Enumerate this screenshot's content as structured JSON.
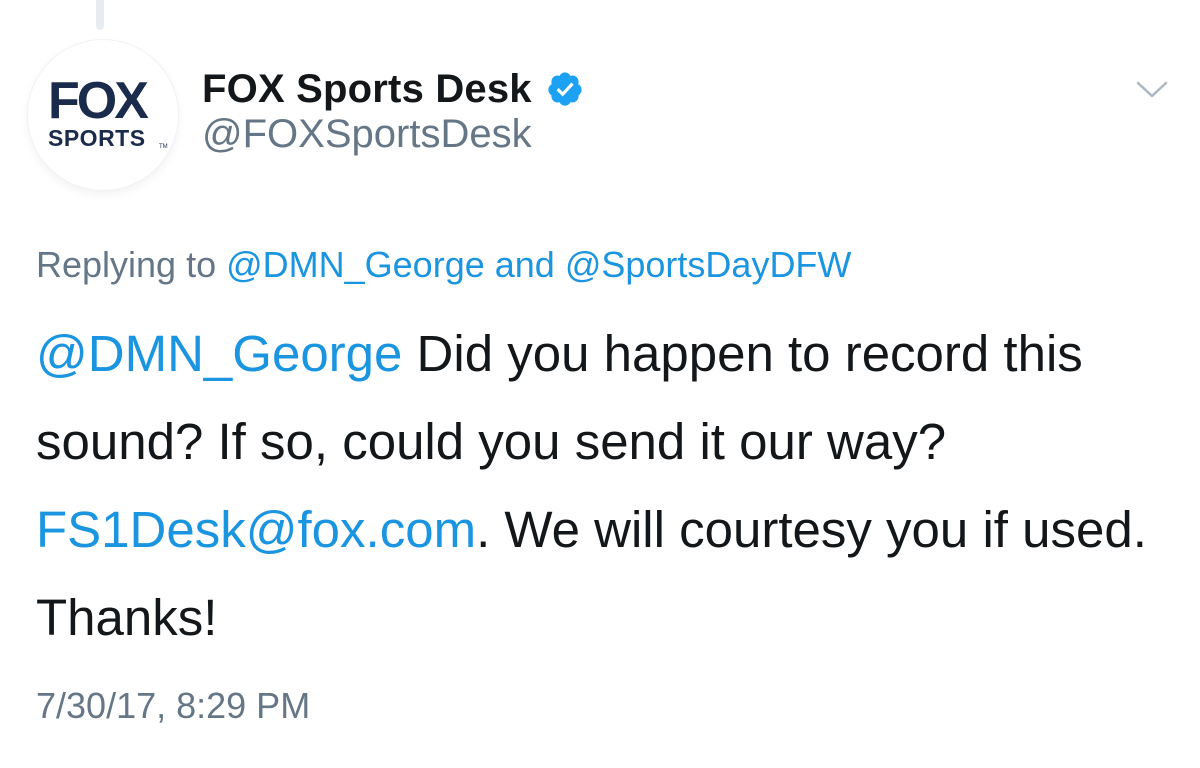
{
  "author": {
    "display_name": "FOX Sports Desk",
    "handle": "@FOXSportsDesk",
    "verified": true,
    "avatar_logo": {
      "top_text": "FOX",
      "bottom_text": "SPORTS",
      "trademark": "TM"
    }
  },
  "reply_context": {
    "prefix": "Replying to ",
    "user1": "@DMN_George",
    "conjunction": " and ",
    "user2": "@SportsDayDFW"
  },
  "tweet": {
    "mention": "@DMN_George",
    "text1": " Did you happen to record this sound? If so, could you send it our way? ",
    "email": "FS1Desk@fox.com",
    "text2": ". We will courtesy you if used. Thanks!"
  },
  "timestamp": "7/30/17, 8:29 PM",
  "icons": {
    "verified": "verified-badge-icon",
    "menu": "chevron-down-icon"
  },
  "colors": {
    "link": "#1b95e0",
    "verified": "#1da1f2",
    "secondary_text": "#657786",
    "primary_text": "#14171a"
  }
}
